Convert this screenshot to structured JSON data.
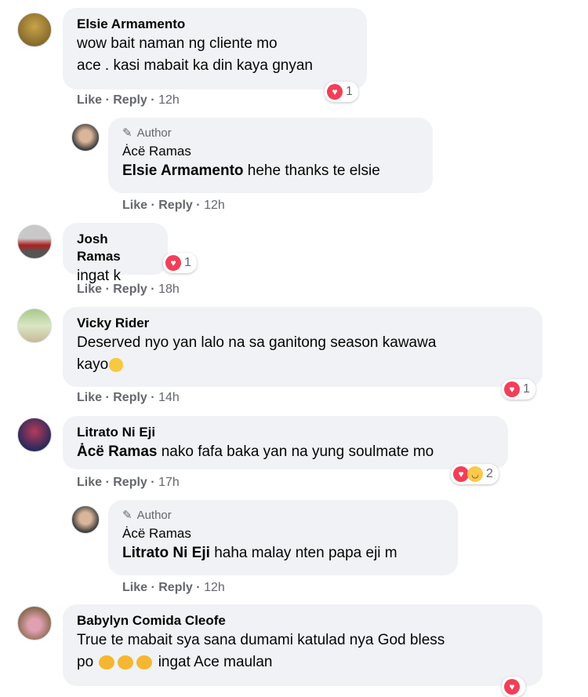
{
  "comments": [
    {
      "name": "Elsie Armamento",
      "text": "wow bait naman ng cliente mo\nace . kasi mabait ka din kaya gnyan",
      "like": "Like",
      "reply": "Reply",
      "time": "12h",
      "react_count": "1"
    },
    {
      "author_tag": "Author",
      "name": "Ȧcë Ramas",
      "mention": "Elsie Armamento",
      "text": "hehe thanks te elsie",
      "like": "Like",
      "reply": "Reply",
      "time": "12h"
    },
    {
      "name": "Josh Ramas",
      "text": "ingat k",
      "like": "Like",
      "reply": "Reply",
      "time": "18h",
      "react_count": "1"
    },
    {
      "name": "Vicky Rider",
      "text_line1": "Deserved nyo yan lalo na sa ganitong season kawawa",
      "text_line2": "kayo",
      "like": "Like",
      "reply": "Reply",
      "time": "14h",
      "react_count": "1"
    },
    {
      "name": "Litrato Ni Eji",
      "mention": "Ȧcë Ramas",
      "text": "nako fafa baka yan na yung soulmate mo",
      "like": "Like",
      "reply": "Reply",
      "time": "17h",
      "react_count": "2"
    },
    {
      "author_tag": "Author",
      "name": "Ȧcë Ramas",
      "mention": "Litrato Ni Eji",
      "text": "haha malay nten papa eji m",
      "like": "Like",
      "reply": "Reply",
      "time": "12h"
    },
    {
      "name": "Babylyn Comida Cleofe",
      "text_line1": "True te mabait sya sana dumami katulad nya God bless",
      "text_line2_pre": "po",
      "text_line2_post": "ingat Ace maulan"
    }
  ],
  "separator": "·",
  "colors": {
    "bubble": "#f0f2f5",
    "meta": "#65676b",
    "heart": "#f33e58"
  }
}
